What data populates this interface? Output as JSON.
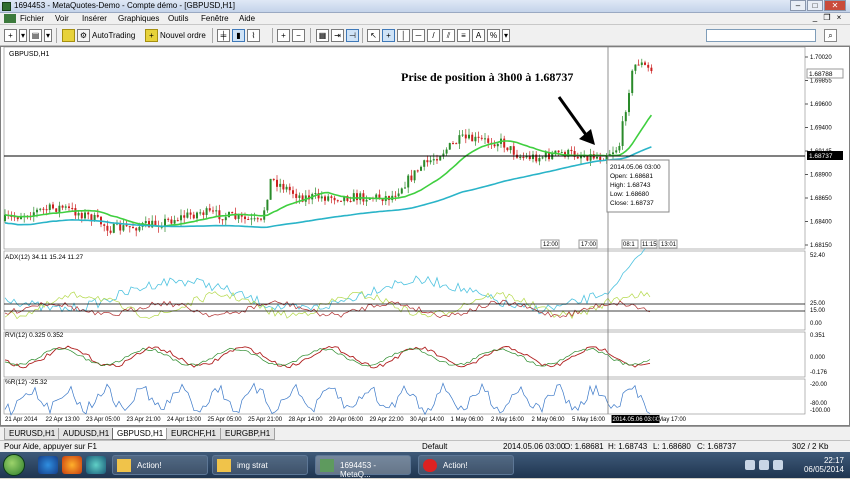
{
  "window": {
    "title": "1694453 - MetaQuotes-Demo - Compte démo - [GBPUSD,H1]",
    "minimize": "–",
    "maximize": "□",
    "close": "✕"
  },
  "menu": [
    "Fichier",
    "Voir",
    "Insérer",
    "Graphiques",
    "Outils",
    "Fenêtre",
    "Aide"
  ],
  "toolbar": {
    "autotrading_label": "AutoTrading",
    "new_order_label": "Nouvel ordre",
    "search_placeholder": ""
  },
  "chart": {
    "symbol_label": "GBPUSD,H1",
    "annotation": "Prise de position à 3h00 à 1.68737",
    "price_ticks": [
      "1.70020",
      "1.69855",
      "1.69600",
      "1.69400",
      "1.69145",
      "1.68900",
      "1.68650",
      "1.68400",
      "1.68150"
    ],
    "current_price": "1.68788",
    "highlight_price": "1.68737",
    "tooltip": [
      "2014.05.06 03:00",
      "Open: 1.68681",
      "High: 1.68743",
      "Low: 1.68680",
      "Close: 1.68737"
    ],
    "session_labels": [
      "12:00",
      "17:00",
      "08:1",
      "11:15",
      "13:01"
    ],
    "time_axis": [
      "21 Apr 2014",
      "22 Apr 13:00",
      "23 Apr 05:00",
      "23 Apr 21:00",
      "24 Apr 13:00",
      "25 Apr 05:00",
      "25 Apr 21:00",
      "28 Apr 14:00",
      "29 Apr 06:00",
      "29 Apr 22:00",
      "30 Apr 14:00",
      "1 May 06:00",
      "2 May 16:00",
      "2 May 06:00",
      "5 May 16:00",
      "2014.05.06 03:00",
      "6 May 17:00"
    ],
    "adx": {
      "label": "ADX(12) 34.11 15.24 11.27",
      "ticks": [
        "52.40",
        "25.00",
        "15.00",
        "0.00"
      ]
    },
    "rvi": {
      "label": "RVI(12) 0.325 0.352",
      "ticks": [
        "0.351",
        "0.000",
        "-0.176"
      ]
    },
    "wpr": {
      "label": "%R(12) -25.32",
      "ticks": [
        "-20.00",
        "-80.00",
        "-100.00"
      ]
    }
  },
  "tabs": [
    "EURUSD,H1",
    "AUDUSD,H1",
    "GBPUSD,H1",
    "EURCHF,H1",
    "EURGBP,H1"
  ],
  "active_tab": "GBPUSD,H1",
  "status": {
    "help": "Pour Aide, appuyer sur F1",
    "profile": "Default",
    "datetime": "2014.05.06 03:00",
    "open": "O: 1.68681",
    "high": "H: 1.68743",
    "low": "L: 1.68680",
    "close": "C: 1.68737",
    "traffic": "302 / 2 Kb"
  },
  "taskbar": {
    "items": [
      "Action!",
      "img strat",
      "1694453 - MetaQ...",
      "Action!"
    ],
    "time": "22:17",
    "date": "06/05/2014"
  },
  "colors": {
    "bull": "#2a8a2a",
    "bear": "#cc1f1f",
    "ma_fast": "#3fcf3f",
    "ma_slow": "#2ab4c8",
    "adx_main": "#4fc3e0",
    "adx_plus": "#b4d94a",
    "adx_minus": "#b03030",
    "wpr": "#3a78c8"
  }
}
